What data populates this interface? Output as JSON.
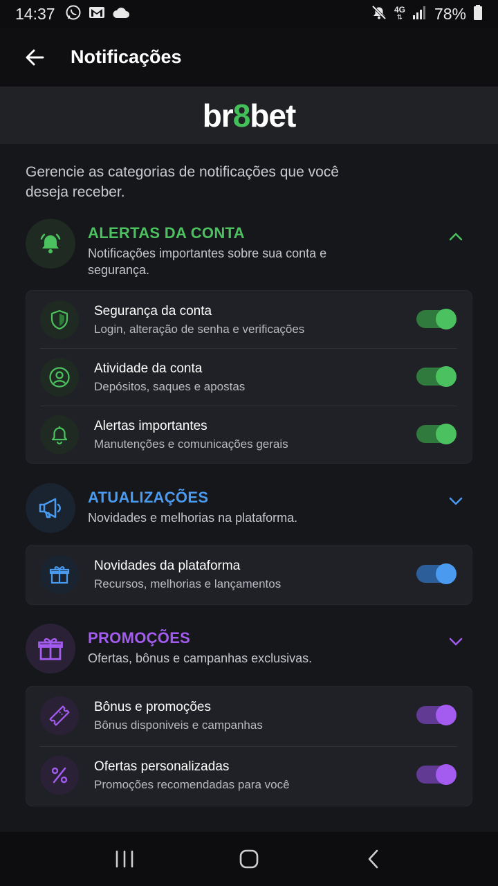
{
  "status_bar": {
    "time": "14:37",
    "network": "4G",
    "battery": "78%",
    "left_icons": [
      "whatsapp-icon",
      "gmail-icon",
      "cloud-icon"
    ],
    "right_icons": [
      "mute-icon",
      "network-4g-icon",
      "signal-icon",
      "battery-icon"
    ]
  },
  "app_bar": {
    "title": "Notificações"
  },
  "brand": {
    "part1": "br",
    "part2": "8",
    "part3": "bet",
    "accent_color": "#43c059"
  },
  "intro": "Gerencie as categorias de notificações que você deseja receber.",
  "sections": [
    {
      "title": "ALERTAS DA CONTA",
      "description": "Notificações importantes sobre sua conta e segurança.",
      "color": "#4cc15f",
      "expanded": true,
      "icon": "bell-icon",
      "items": [
        {
          "title": "Segurança da conta",
          "subtitle": "Login, alteração de senha e verificações",
          "icon": "shield-icon",
          "enabled": true
        },
        {
          "title": "Atividade da conta",
          "subtitle": "Depósitos, saques e apostas",
          "icon": "user-circle-icon",
          "enabled": true
        },
        {
          "title": "Alertas importantes",
          "subtitle": "Manutenções e comunicações gerais",
          "icon": "bell-outline-icon",
          "enabled": true
        }
      ]
    },
    {
      "title": "ATUALIZAÇÕES",
      "description": "Novidades e melhorias na plataforma.",
      "color": "#4a9bf0",
      "expanded": false,
      "icon": "megaphone-icon",
      "items": [
        {
          "title": "Novidades da plataforma",
          "subtitle": "Recursos, melhorias e lançamentos",
          "icon": "gift-icon",
          "enabled": true
        }
      ]
    },
    {
      "title": "PROMOÇÕES",
      "description": "Ofertas, bônus e campanhas exclusivas.",
      "color": "#a35bf0",
      "expanded": false,
      "icon": "gift-icon",
      "items": [
        {
          "title": "Bônus e promoções",
          "subtitle": "Bônus disponiveis e campanhas",
          "icon": "ticket-icon",
          "enabled": true
        },
        {
          "title": "Ofertas personalizadas",
          "subtitle": "Promoções recomendadas para você",
          "icon": "percent-icon",
          "enabled": true
        }
      ]
    }
  ],
  "nav_bar": {
    "buttons": [
      "recents-icon",
      "home-icon",
      "back-nav-icon"
    ]
  }
}
